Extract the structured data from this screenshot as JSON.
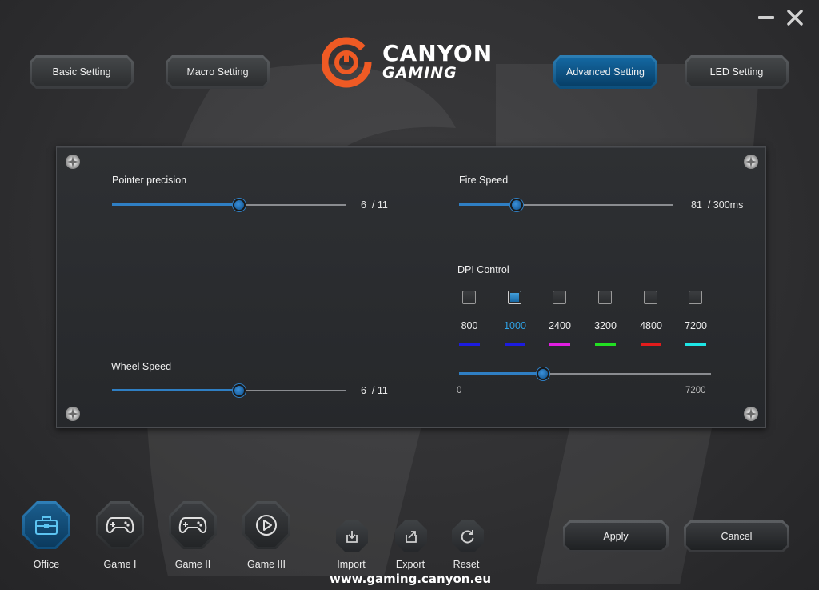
{
  "window": {
    "minimize": "minimize",
    "close": "close"
  },
  "brand": {
    "title": "CANYON",
    "subtitle": "GAMING",
    "url": "www.gaming.canyon.eu",
    "accent": "#ef5a24"
  },
  "nav": {
    "basic": "Basic Setting",
    "macro": "Macro Setting",
    "advanced": "Advanced Setting",
    "led": "LED Setting",
    "active": "advanced"
  },
  "pointer_precision": {
    "label": "Pointer precision",
    "value": 6,
    "max": 11,
    "readout": "6  / 11"
  },
  "wheel_speed": {
    "label": "Wheel Speed",
    "value": 6,
    "max": 11,
    "readout": "6  / 11"
  },
  "fire_speed": {
    "label": "Fire Speed",
    "value": 81,
    "max": 300,
    "readout": "81  / 300ms"
  },
  "dpi": {
    "label": "DPI Control",
    "levels": [
      {
        "value": "800",
        "color": "#1c1ce0",
        "checked": false
      },
      {
        "value": "1000",
        "color": "#1c1ce0",
        "checked": true
      },
      {
        "value": "2400",
        "color": "#e21ee2",
        "checked": false
      },
      {
        "value": "3200",
        "color": "#22e022",
        "checked": false
      },
      {
        "value": "4800",
        "color": "#e21c1c",
        "checked": false
      },
      {
        "value": "7200",
        "color": "#1ee6e6",
        "checked": false
      }
    ],
    "selected_color": "#2fa4e8",
    "slider_min": "0",
    "slider_max": "7200",
    "slider_value": 2400
  },
  "profiles": [
    {
      "label": "Office",
      "icon": "briefcase-icon",
      "active": true
    },
    {
      "label": "Game I",
      "icon": "gamepad-icon",
      "active": false
    },
    {
      "label": "Game II",
      "icon": "gamepad-icon",
      "active": false
    },
    {
      "label": "Game III",
      "icon": "play-icon",
      "active": false
    }
  ],
  "tools": {
    "import": "Import",
    "export": "Export",
    "reset": "Reset"
  },
  "actions": {
    "apply": "Apply",
    "cancel": "Cancel"
  }
}
